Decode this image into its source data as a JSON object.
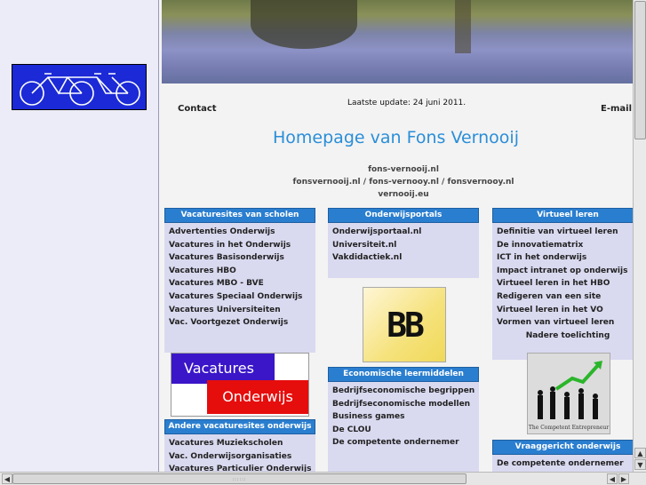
{
  "header": {
    "contact_label": "Contact",
    "updated_text": "Laatste update: 24 juni 2011.",
    "email_label": "E-mail"
  },
  "page_title": "Homepage van Fons Vernooij",
  "domains": [
    "fons-vernooij.nl",
    "fonsvernooij.nl / fons-vernooy.nl / fonsvernooy.nl",
    "vernooij.eu"
  ],
  "col1": {
    "header": "Vacaturesites van scholen",
    "items": [
      "Advertenties Onderwijs",
      "Vacatures in het Onderwijs",
      "Vacatures Basisonderwijs",
      "Vacatures HBO",
      "Vacatures MBO - BVE",
      "Vacatures Speciaal Onderwijs",
      "Vacatures Universiteiten",
      "Vac. Voortgezet Onderwijs"
    ],
    "logo_top": "Vacatures",
    "logo_bottom": "Onderwijs",
    "header2": "Andere vacaturesites onderwijs",
    "items2": [
      "Vacatures Muziekscholen",
      "Vac. Onderwijsorganisaties",
      "Vacatures Particulier Onderwijs"
    ]
  },
  "col2": {
    "header": "Onderwijsportals",
    "items": [
      "Onderwijsportaal.nl",
      "Universiteit.nl",
      "Vakdidactiek.nl"
    ],
    "logo_text": "BB",
    "header2": "Economische leermiddelen",
    "items2": [
      "Bedrijfseconomische begrippen",
      "Bedrijfseconomische modellen",
      "Business games",
      "De CLOU",
      "De competente ondernemer"
    ]
  },
  "col3": {
    "header": "Virtueel leren",
    "items": [
      "Definitie van virtueel leren",
      "De innovatiematrix",
      "ICT in het onderwijs",
      "Impact intranet op onderwijs",
      "Virtueel leren in het HBO",
      "Redigeren van een site",
      "Virtueel leren in het VO",
      "Vormen van virtueel leren"
    ],
    "more_label": "Nadere toelichting",
    "logo_caption": "The Competent Entrepreneur",
    "header2": "Vraaggericht onderwijs",
    "items2": [
      "De competente ondernemer"
    ]
  },
  "scrollbar": {
    "up": "▲",
    "down": "▼",
    "left": "◀",
    "right": "▶",
    "grip": "::::::"
  },
  "colors": {
    "header_blue": "#2a7ecf",
    "title_blue": "#2a8ed8",
    "list_bg": "#d9d9f0"
  }
}
